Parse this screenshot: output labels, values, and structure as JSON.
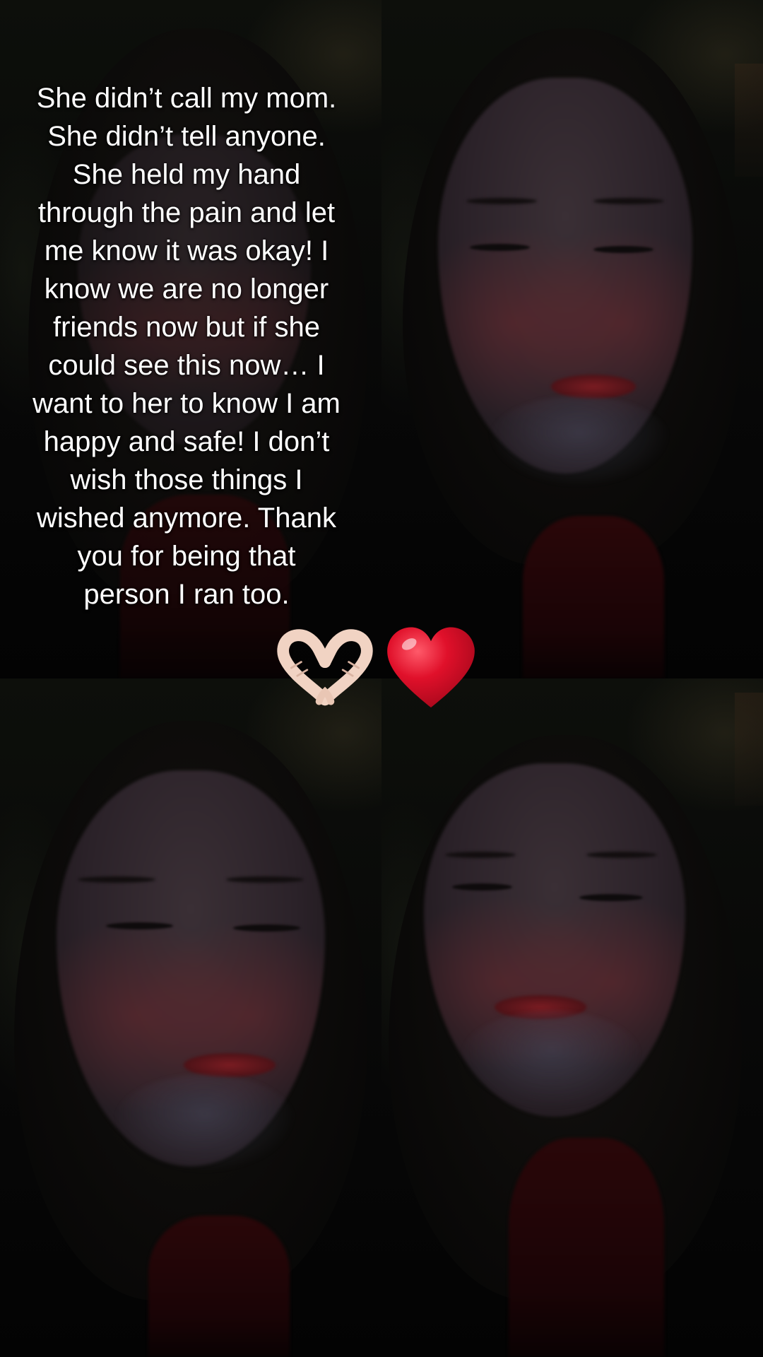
{
  "caption": {
    "text": "She didn’t call my mom.\nShe didn’t tell anyone.\nShe held my hand\nthrough the pain and let\nme know it was okay! I\nknow we are no longer\nfriends now but if she\ncould see this now… I\nwant to her to know I am\nhappy and safe! I don’t\nwish those things I\nwished anymore. Thank\nyou for being that\nperson I ran too."
  },
  "emojis": [
    {
      "icon": "heart-hands-icon",
      "color": "#f1d3c3"
    },
    {
      "icon": "red-heart-icon",
      "color": "#e0102a"
    }
  ],
  "theme": {
    "background": "#060606",
    "caption_color": "#ffffff",
    "shirt_color": "#2a0709"
  }
}
